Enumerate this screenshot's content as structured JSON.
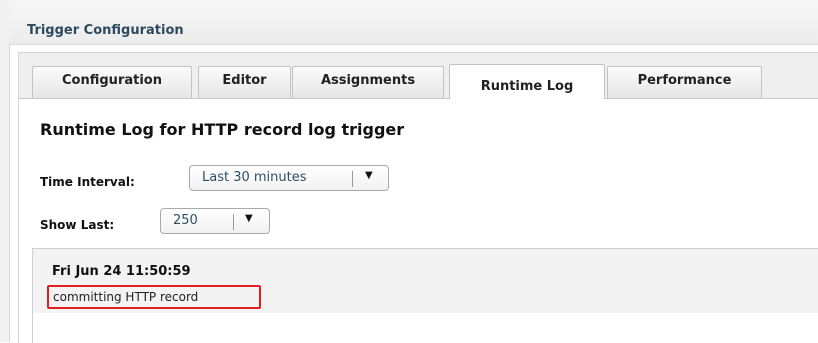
{
  "panel": {
    "title": "Trigger Configuration"
  },
  "tabs": [
    {
      "label": "Configuration",
      "active": false
    },
    {
      "label": "Editor",
      "active": false
    },
    {
      "label": "Assignments",
      "active": false
    },
    {
      "label": "Runtime Log",
      "active": true
    },
    {
      "label": "Performance",
      "active": false
    }
  ],
  "runtime_log": {
    "heading": "Runtime Log for HTTP record log trigger",
    "time_interval": {
      "label": "Time Interval:",
      "value": "Last 30 minutes",
      "icon": "chevron-down-icon"
    },
    "show_last": {
      "label": "Show Last:",
      "value": "250",
      "icon": "chevron-down-icon"
    },
    "entries": [
      {
        "timestamp": "Fri Jun 24 11:50:59",
        "message": "committing HTTP record"
      }
    ]
  },
  "colors": {
    "highlight_border": "#e02020",
    "title_text": "#2e4a5e",
    "select_text": "#2e5066"
  }
}
